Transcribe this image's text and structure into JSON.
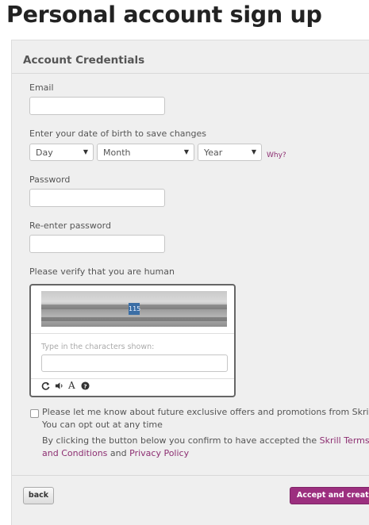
{
  "page": {
    "title": "Personal account sign up"
  },
  "section": {
    "title": "Account Credentials"
  },
  "email": {
    "label": "Email",
    "value": ""
  },
  "dob": {
    "label": "Enter your date of birth to save changes",
    "day": "Day",
    "month": "Month",
    "year": "Year",
    "why_link": "Why?"
  },
  "password": {
    "label": "Password",
    "value": ""
  },
  "reenter_password": {
    "label": "Re-enter password",
    "value": ""
  },
  "captcha": {
    "label": "Please verify that you are human",
    "image_text": "115",
    "hint": "Type in the characters shown:",
    "value": ""
  },
  "offers": {
    "checked": false,
    "text": "Please let me know about future exclusive offers and promotions from Skrill. You can opt out at any time"
  },
  "terms": {
    "prefix": "By clicking the button below you confirm to have accepted the",
    "terms_link": "Skrill Terms and Conditions",
    "and": "and",
    "privacy_link": "Privacy Policy"
  },
  "actions": {
    "back_label": "back",
    "accept_label": "Accept and create account"
  },
  "colors": {
    "link": "#8d2f72",
    "primary_button": "#9c2f7f"
  }
}
